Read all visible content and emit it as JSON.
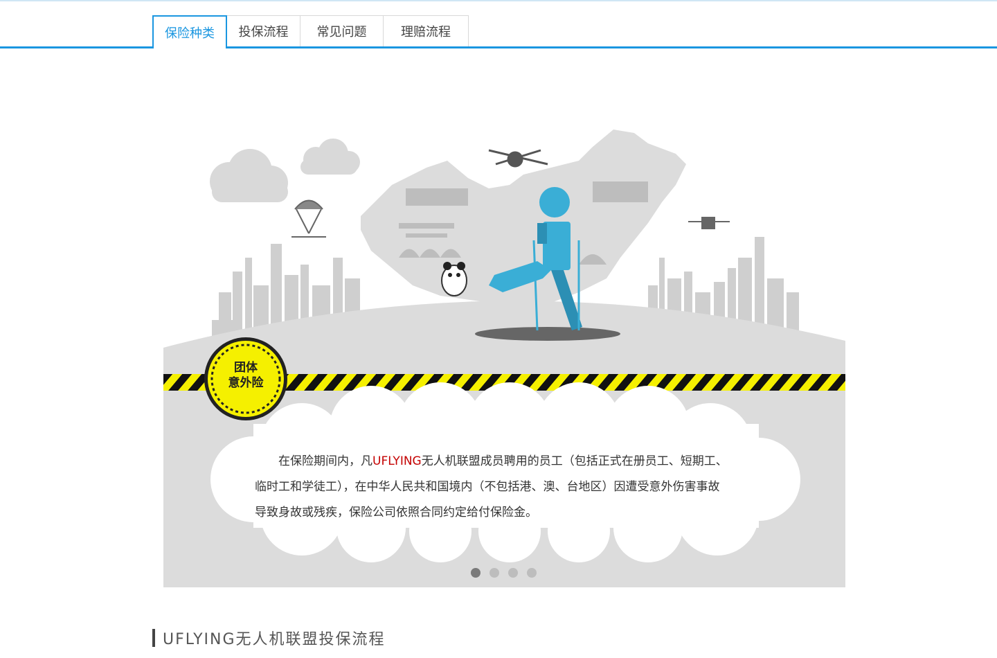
{
  "tabs": [
    {
      "label": "保险种类",
      "active": true
    },
    {
      "label": "投保流程",
      "active": false
    },
    {
      "label": "常见问题",
      "active": false
    },
    {
      "label": "理赔流程",
      "active": false
    }
  ],
  "banner": {
    "badge": {
      "line1": "团体",
      "line2": "意外险"
    },
    "description": {
      "before_brand": "在保险期间内，凡",
      "brand": "UFLYING",
      "line1_rest": "无人机联盟成员聘用的员工（包括正式在册员工、短期工、",
      "line2": "临时工和学徒工），在中华人民共和国境内（不包括港、澳、台地区）因遭受意外伤害事故",
      "line3": "导致身故或残疾，保险公司依照合同约定给付保险金。"
    },
    "slides_count": 4,
    "active_slide": 1
  },
  "section": {
    "title": "UFLYING无人机联盟投保流程"
  },
  "colors": {
    "accent": "#1a96e0",
    "brand_red": "#c40000",
    "warning_yellow": "#f5f000",
    "figure_blue": "#3aaed6"
  },
  "icons": [
    "drone-icon",
    "parachute-drone-icon",
    "panda-icon",
    "injured-person-icon",
    "stripe-tape"
  ]
}
